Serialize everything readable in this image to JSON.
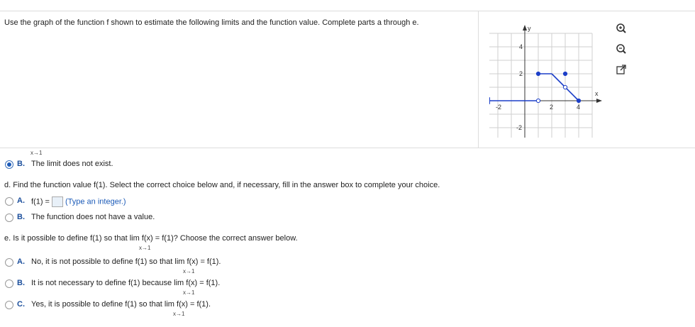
{
  "instruction": "Use the graph of the function f shown to estimate the following limits and the function value. Complete parts a through e.",
  "graph": {
    "y_label": "y",
    "x_label": "x",
    "x_ticks": [
      "-2",
      "2",
      "4"
    ],
    "y_ticks": [
      "4",
      "2",
      "-2"
    ],
    "line_color": "#1c3fc8",
    "chart_data": {
      "type": "line",
      "xlim": [
        -3,
        5
      ],
      "ylim": [
        -3,
        5
      ],
      "grid": true,
      "segments": [
        {
          "from": [
            -3,
            0
          ],
          "to": [
            1,
            0
          ],
          "left_arrow": true,
          "end": "open"
        },
        {
          "from": [
            1,
            2
          ],
          "to": [
            2,
            2
          ],
          "start": "closed"
        },
        {
          "from": [
            2,
            2
          ],
          "to": [
            3,
            1
          ],
          "end": "open"
        },
        {
          "from": [
            3,
            1
          ],
          "to": [
            4,
            0
          ],
          "end": "closed"
        }
      ],
      "points": [
        {
          "x": 1,
          "y": 0,
          "style": "open"
        },
        {
          "x": 1,
          "y": 2,
          "style": "closed"
        },
        {
          "x": 3,
          "y": 2,
          "style": "closed"
        },
        {
          "x": 3,
          "y": 1,
          "style": "open"
        },
        {
          "x": 4,
          "y": 0,
          "style": "closed"
        }
      ]
    }
  },
  "tools": [
    "zoom-in-icon",
    "zoom-out-icon",
    "popout-icon"
  ],
  "partial_sub": "x→1",
  "part_c_b": {
    "letter": "B.",
    "text": "The limit does not exist."
  },
  "part_d": {
    "question": "d. Find the function value f(1). Select the correct choice below and, if necessary, fill in the answer box to complete your choice.",
    "a_letter": "A.",
    "a_prefix": "f(1) =",
    "a_hint": "(Type an integer.)",
    "b_letter": "B.",
    "b_text": "The function does not have a value."
  },
  "part_e": {
    "q_pre": "e. Is it possible to define f(1) so that lim",
    "q_post": "f(x) = f(1)? Choose the correct answer below.",
    "sub": "x→1",
    "options": [
      {
        "letter": "A.",
        "pre": "No, it is not possible to define f(1) so that lim",
        "post": "f(x) = f(1).",
        "sub": "x→1"
      },
      {
        "letter": "B.",
        "pre": "It is not necessary to define f(1) because lim",
        "post": "f(x) = f(1).",
        "sub": "x→1"
      },
      {
        "letter": "C.",
        "pre": "Yes, it is possible to define f(1) so that lim",
        "post": "f(x) = f(1).",
        "sub": "x→1"
      }
    ]
  }
}
